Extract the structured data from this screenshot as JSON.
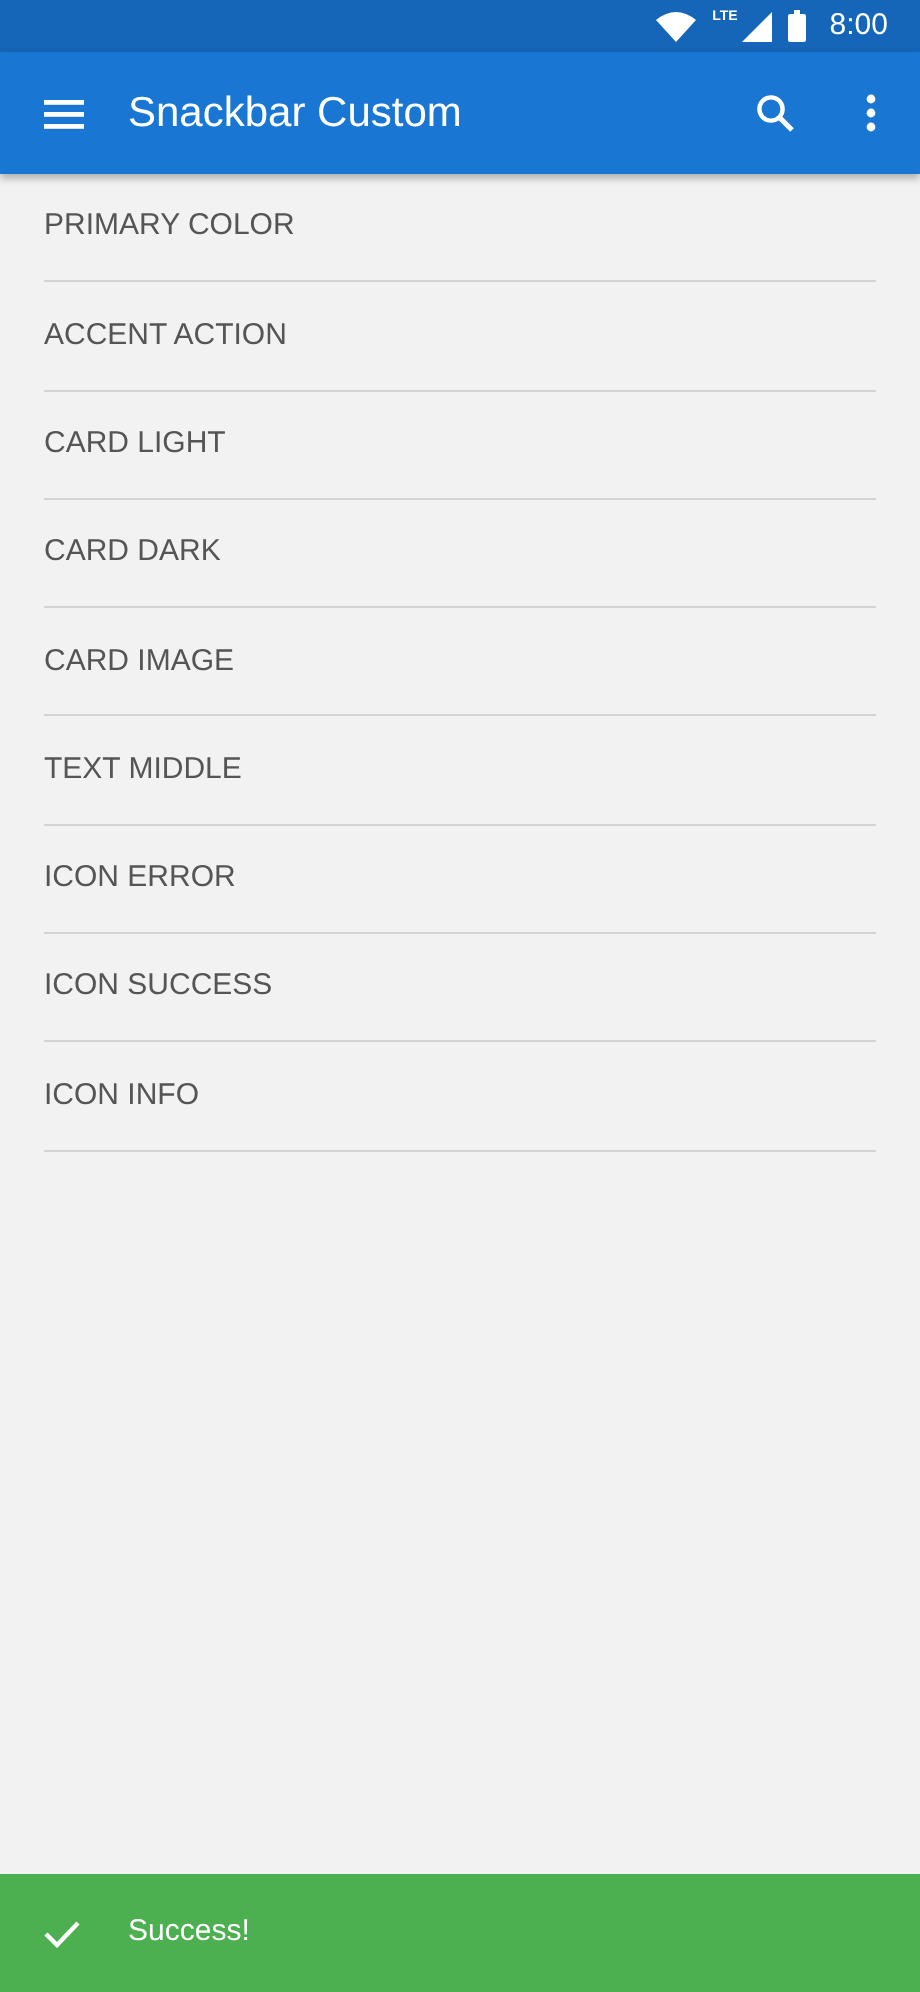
{
  "status_bar": {
    "network": "LTE",
    "time": "8:00"
  },
  "app_bar": {
    "title": "Snackbar Custom"
  },
  "items": [
    "PRIMARY COLOR",
    "ACCENT ACTION",
    "CARD LIGHT",
    "CARD DARK",
    "CARD IMAGE",
    "TEXT MIDDLE",
    "ICON ERROR",
    "ICON SUCCESS",
    "ICON INFO"
  ],
  "snackbar": {
    "message": "Success!",
    "color": "#4caf50"
  }
}
